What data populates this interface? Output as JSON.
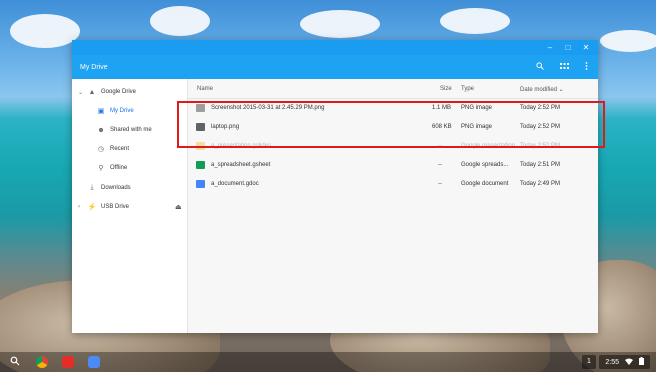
{
  "window": {
    "title": "My Drive",
    "controls": {
      "minimize": "–",
      "maximize": "□",
      "close": "✕"
    }
  },
  "toolbar": {
    "icons": [
      "search-icon",
      "grid-view-icon",
      "more-options-icon"
    ]
  },
  "sidebar": {
    "items": [
      {
        "label": "Google Drive",
        "icon": "drive-icon",
        "expanded": true
      },
      {
        "label": "My Drive",
        "icon": "folder-drive-icon",
        "active": true
      },
      {
        "label": "Shared with me",
        "icon": "people-icon"
      },
      {
        "label": "Recent",
        "icon": "clock-icon"
      },
      {
        "label": "Offline",
        "icon": "pin-icon"
      },
      {
        "label": "Downloads",
        "icon": "download-icon"
      },
      {
        "label": "USB Drive",
        "icon": "usb-icon"
      }
    ]
  },
  "filelist": {
    "columns": {
      "name": "Name",
      "size": "Size",
      "type": "Type",
      "date": "Date modified ⌄"
    },
    "rows": [
      {
        "name": "Screenshot 2015-03-31 at 2.45.29 PM.png",
        "size": "1.1 MB",
        "type": "PNG image",
        "date": "Today 2:52 PM",
        "icon_color": "#9e9e9e"
      },
      {
        "name": "laptop.png",
        "size": "608 KB",
        "type": "PNG image",
        "date": "Today 2:52 PM",
        "icon_color": "#5f6368"
      },
      {
        "name": "a_presentation.gslides",
        "size": "--",
        "type": "Google presentation",
        "date": "Today 2:52 PM",
        "icon_color": "#f4b400"
      },
      {
        "name": "a_spreadsheet.gsheet",
        "size": "--",
        "type": "Google spreads...",
        "date": "Today 2:51 PM",
        "icon_color": "#0f9d58"
      },
      {
        "name": "a_document.gdoc",
        "size": "--",
        "type": "Google document",
        "date": "Today 2:49 PM",
        "icon_color": "#4285f4"
      }
    ]
  },
  "shelf": {
    "notification_count": "1",
    "time": "2:55"
  },
  "colors": {
    "titlebar": "#1a9cf0",
    "highlight": "#e01a1a",
    "active_nav": "#1a73e8"
  }
}
